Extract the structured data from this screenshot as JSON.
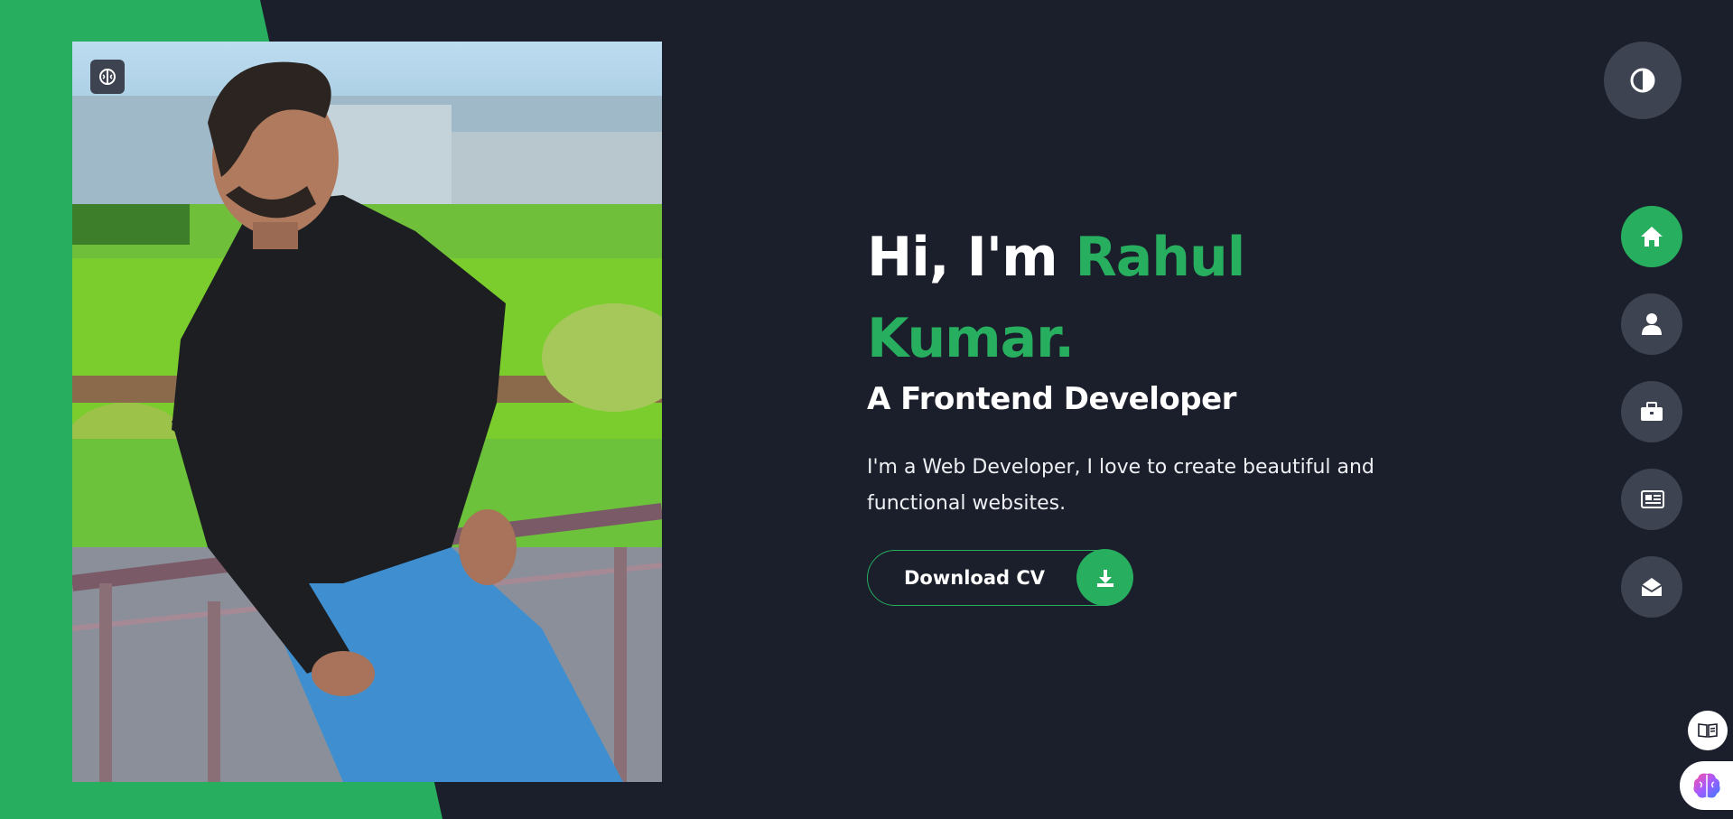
{
  "theme": {
    "accent": "#27ae5f",
    "background": "#1b1e2b",
    "button_bg": "#3d4350"
  },
  "hero": {
    "greeting": "Hi, I'm",
    "name": "Rahul Kumar.",
    "title": "A Frontend Developer",
    "bio": "I'm a Web Developer, I love to create beautiful and functional websites.",
    "photo_alt": "Portrait of Rahul Kumar"
  },
  "cv_button": {
    "label": "Download CV",
    "icon": "download-icon"
  },
  "theme_toggle": {
    "icon": "contrast-icon"
  },
  "nav": [
    {
      "id": "home",
      "icon": "home-icon",
      "active": true
    },
    {
      "id": "about",
      "icon": "user-icon",
      "active": false
    },
    {
      "id": "portfolio",
      "icon": "briefcase-icon",
      "active": false
    },
    {
      "id": "blog",
      "icon": "newspaper-icon",
      "active": false
    },
    {
      "id": "contact",
      "icon": "envelope-open-icon",
      "active": false
    }
  ],
  "extensions": [
    {
      "icon": "reader-icon"
    },
    {
      "icon": "brain-icon"
    }
  ]
}
